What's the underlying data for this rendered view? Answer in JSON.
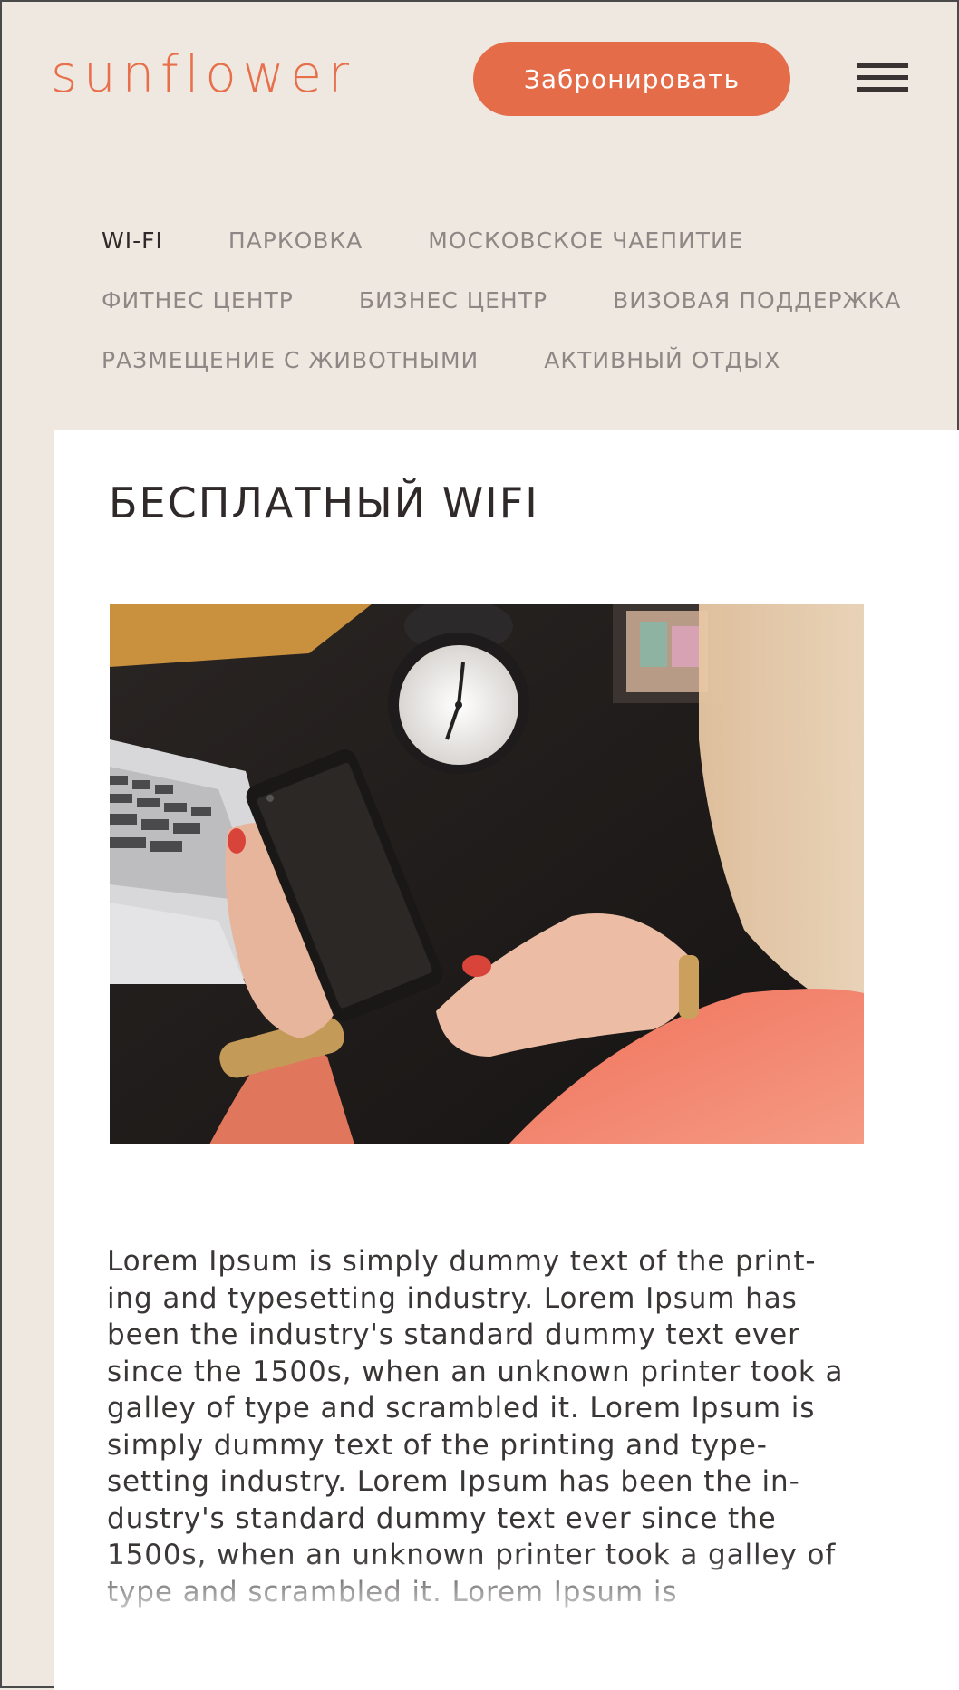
{
  "header": {
    "logo": "sunflower",
    "book_button": "Забронировать",
    "menu_icon": "hamburger-menu-icon"
  },
  "tabs": {
    "rows": [
      [
        "WI-FI",
        "ПАРКОВКА",
        "МОСКОВСКОЕ ЧАЕПИТИЕ"
      ],
      [
        "ФИТНЕС ЦЕНТР",
        "БИЗНЕС ЦЕНТР",
        "ВИЗОВАЯ ПОДДЕРЖКА"
      ],
      [
        "РАЗМЕЩЕНИЕ С ЖИВОТНЫМИ",
        "АКТИВНЫЙ ОТДЫХ"
      ]
    ],
    "active": "WI-FI"
  },
  "content": {
    "title": "БЕСПЛАТНЫЙ WIFI",
    "body": "Lorem Ipsum is simply dummy text of the print- ing and typesetting industry. Lorem Ipsum has been the industry's standard dummy text ever since the 1500s, when an unknown printer took a galley of type and scrambled it. Lorem Ipsum is simply dummy text of the printing and type- setting industry. Lorem Ipsum has been the in- dustry's standard dummy text ever since the 1500s, when an unknown printer took a galley of type and scrambled it. Lorem Ipsum is"
  },
  "colors": {
    "background": "#efe8e1",
    "accent": "#e56c48",
    "text_dark": "#2f2929",
    "tab_inactive": "#8f8785",
    "card": "#ffffff"
  }
}
